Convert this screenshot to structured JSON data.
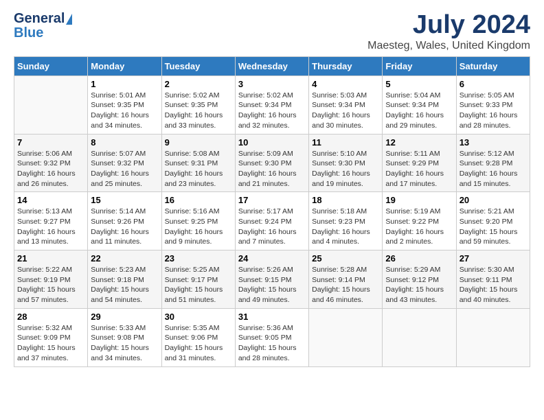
{
  "logo": {
    "general": "General",
    "blue": "Blue"
  },
  "title": "July 2024",
  "subtitle": "Maesteg, Wales, United Kingdom",
  "days_of_week": [
    "Sunday",
    "Monday",
    "Tuesday",
    "Wednesday",
    "Thursday",
    "Friday",
    "Saturday"
  ],
  "weeks": [
    [
      {
        "day": "",
        "info": ""
      },
      {
        "day": "1",
        "info": "Sunrise: 5:01 AM\nSunset: 9:35 PM\nDaylight: 16 hours\nand 34 minutes."
      },
      {
        "day": "2",
        "info": "Sunrise: 5:02 AM\nSunset: 9:35 PM\nDaylight: 16 hours\nand 33 minutes."
      },
      {
        "day": "3",
        "info": "Sunrise: 5:02 AM\nSunset: 9:34 PM\nDaylight: 16 hours\nand 32 minutes."
      },
      {
        "day": "4",
        "info": "Sunrise: 5:03 AM\nSunset: 9:34 PM\nDaylight: 16 hours\nand 30 minutes."
      },
      {
        "day": "5",
        "info": "Sunrise: 5:04 AM\nSunset: 9:34 PM\nDaylight: 16 hours\nand 29 minutes."
      },
      {
        "day": "6",
        "info": "Sunrise: 5:05 AM\nSunset: 9:33 PM\nDaylight: 16 hours\nand 28 minutes."
      }
    ],
    [
      {
        "day": "7",
        "info": "Sunrise: 5:06 AM\nSunset: 9:32 PM\nDaylight: 16 hours\nand 26 minutes."
      },
      {
        "day": "8",
        "info": "Sunrise: 5:07 AM\nSunset: 9:32 PM\nDaylight: 16 hours\nand 25 minutes."
      },
      {
        "day": "9",
        "info": "Sunrise: 5:08 AM\nSunset: 9:31 PM\nDaylight: 16 hours\nand 23 minutes."
      },
      {
        "day": "10",
        "info": "Sunrise: 5:09 AM\nSunset: 9:30 PM\nDaylight: 16 hours\nand 21 minutes."
      },
      {
        "day": "11",
        "info": "Sunrise: 5:10 AM\nSunset: 9:30 PM\nDaylight: 16 hours\nand 19 minutes."
      },
      {
        "day": "12",
        "info": "Sunrise: 5:11 AM\nSunset: 9:29 PM\nDaylight: 16 hours\nand 17 minutes."
      },
      {
        "day": "13",
        "info": "Sunrise: 5:12 AM\nSunset: 9:28 PM\nDaylight: 16 hours\nand 15 minutes."
      }
    ],
    [
      {
        "day": "14",
        "info": "Sunrise: 5:13 AM\nSunset: 9:27 PM\nDaylight: 16 hours\nand 13 minutes."
      },
      {
        "day": "15",
        "info": "Sunrise: 5:14 AM\nSunset: 9:26 PM\nDaylight: 16 hours\nand 11 minutes."
      },
      {
        "day": "16",
        "info": "Sunrise: 5:16 AM\nSunset: 9:25 PM\nDaylight: 16 hours\nand 9 minutes."
      },
      {
        "day": "17",
        "info": "Sunrise: 5:17 AM\nSunset: 9:24 PM\nDaylight: 16 hours\nand 7 minutes."
      },
      {
        "day": "18",
        "info": "Sunrise: 5:18 AM\nSunset: 9:23 PM\nDaylight: 16 hours\nand 4 minutes."
      },
      {
        "day": "19",
        "info": "Sunrise: 5:19 AM\nSunset: 9:22 PM\nDaylight: 16 hours\nand 2 minutes."
      },
      {
        "day": "20",
        "info": "Sunrise: 5:21 AM\nSunset: 9:20 PM\nDaylight: 15 hours\nand 59 minutes."
      }
    ],
    [
      {
        "day": "21",
        "info": "Sunrise: 5:22 AM\nSunset: 9:19 PM\nDaylight: 15 hours\nand 57 minutes."
      },
      {
        "day": "22",
        "info": "Sunrise: 5:23 AM\nSunset: 9:18 PM\nDaylight: 15 hours\nand 54 minutes."
      },
      {
        "day": "23",
        "info": "Sunrise: 5:25 AM\nSunset: 9:17 PM\nDaylight: 15 hours\nand 51 minutes."
      },
      {
        "day": "24",
        "info": "Sunrise: 5:26 AM\nSunset: 9:15 PM\nDaylight: 15 hours\nand 49 minutes."
      },
      {
        "day": "25",
        "info": "Sunrise: 5:28 AM\nSunset: 9:14 PM\nDaylight: 15 hours\nand 46 minutes."
      },
      {
        "day": "26",
        "info": "Sunrise: 5:29 AM\nSunset: 9:12 PM\nDaylight: 15 hours\nand 43 minutes."
      },
      {
        "day": "27",
        "info": "Sunrise: 5:30 AM\nSunset: 9:11 PM\nDaylight: 15 hours\nand 40 minutes."
      }
    ],
    [
      {
        "day": "28",
        "info": "Sunrise: 5:32 AM\nSunset: 9:09 PM\nDaylight: 15 hours\nand 37 minutes."
      },
      {
        "day": "29",
        "info": "Sunrise: 5:33 AM\nSunset: 9:08 PM\nDaylight: 15 hours\nand 34 minutes."
      },
      {
        "day": "30",
        "info": "Sunrise: 5:35 AM\nSunset: 9:06 PM\nDaylight: 15 hours\nand 31 minutes."
      },
      {
        "day": "31",
        "info": "Sunrise: 5:36 AM\nSunset: 9:05 PM\nDaylight: 15 hours\nand 28 minutes."
      },
      {
        "day": "",
        "info": ""
      },
      {
        "day": "",
        "info": ""
      },
      {
        "day": "",
        "info": ""
      }
    ]
  ]
}
